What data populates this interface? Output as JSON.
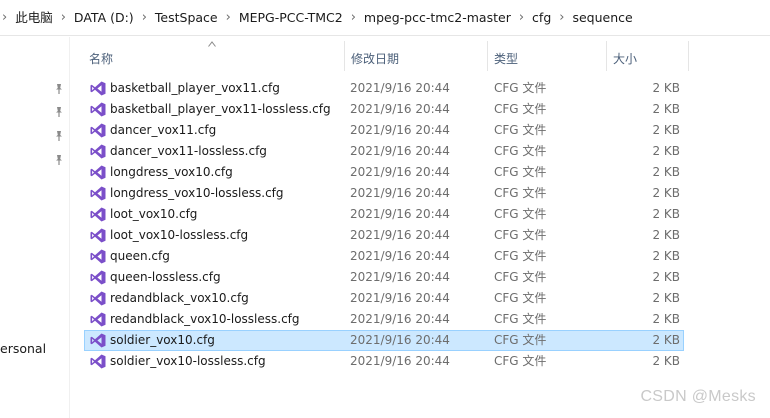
{
  "breadcrumb": [
    "此电脑",
    "DATA (D:)",
    "TestSpace",
    "MEPG-PCC-TMC2",
    "mpeg-pcc-tmc2-master",
    "cfg",
    "sequence"
  ],
  "navpane": {
    "partial_label": "ersonal"
  },
  "columns": {
    "name": "名称",
    "date": "修改日期",
    "type": "类型",
    "size": "大小"
  },
  "files": [
    {
      "name": "basketball_player_vox11.cfg",
      "date": "2021/9/16 20:44",
      "type": "CFG 文件",
      "size": "2 KB"
    },
    {
      "name": "basketball_player_vox11-lossless.cfg",
      "date": "2021/9/16 20:44",
      "type": "CFG 文件",
      "size": "2 KB"
    },
    {
      "name": "dancer_vox11.cfg",
      "date": "2021/9/16 20:44",
      "type": "CFG 文件",
      "size": "2 KB"
    },
    {
      "name": "dancer_vox11-lossless.cfg",
      "date": "2021/9/16 20:44",
      "type": "CFG 文件",
      "size": "2 KB"
    },
    {
      "name": "longdress_vox10.cfg",
      "date": "2021/9/16 20:44",
      "type": "CFG 文件",
      "size": "2 KB"
    },
    {
      "name": "longdress_vox10-lossless.cfg",
      "date": "2021/9/16 20:44",
      "type": "CFG 文件",
      "size": "2 KB"
    },
    {
      "name": "loot_vox10.cfg",
      "date": "2021/9/16 20:44",
      "type": "CFG 文件",
      "size": "2 KB"
    },
    {
      "name": "loot_vox10-lossless.cfg",
      "date": "2021/9/16 20:44",
      "type": "CFG 文件",
      "size": "2 KB"
    },
    {
      "name": "queen.cfg",
      "date": "2021/9/16 20:44",
      "type": "CFG 文件",
      "size": "2 KB"
    },
    {
      "name": "queen-lossless.cfg",
      "date": "2021/9/16 20:44",
      "type": "CFG 文件",
      "size": "2 KB"
    },
    {
      "name": "redandblack_vox10.cfg",
      "date": "2021/9/16 20:44",
      "type": "CFG 文件",
      "size": "2 KB"
    },
    {
      "name": "redandblack_vox10-lossless.cfg",
      "date": "2021/9/16 20:44",
      "type": "CFG 文件",
      "size": "2 KB"
    },
    {
      "name": "soldier_vox10.cfg",
      "date": "2021/9/16 20:44",
      "type": "CFG 文件",
      "size": "2 KB",
      "selected": true
    },
    {
      "name": "soldier_vox10-lossless.cfg",
      "date": "2021/9/16 20:44",
      "type": "CFG 文件",
      "size": "2 KB"
    }
  ],
  "watermark": "CSDN @Mesks",
  "colors": {
    "selected_bg": "#cce8ff",
    "selected_border": "#99d1ff",
    "file_icon": "#7b4fc9"
  }
}
